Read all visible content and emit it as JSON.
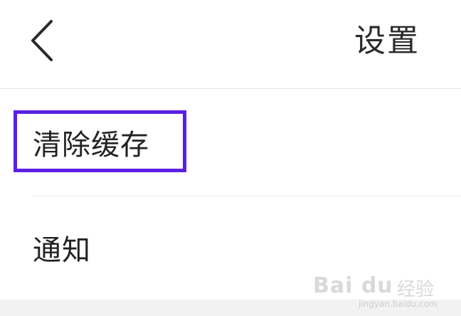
{
  "header": {
    "title": "设置",
    "back_icon": "chevron-left-icon"
  },
  "rows": [
    {
      "label": "清除缓存",
      "highlighted": true
    },
    {
      "label": "通知",
      "highlighted": false
    }
  ],
  "highlight_color": "#5b1fe3",
  "watermark": {
    "logo": "Bai du",
    "text": "经验",
    "url": "jingyan.baidu.com"
  }
}
